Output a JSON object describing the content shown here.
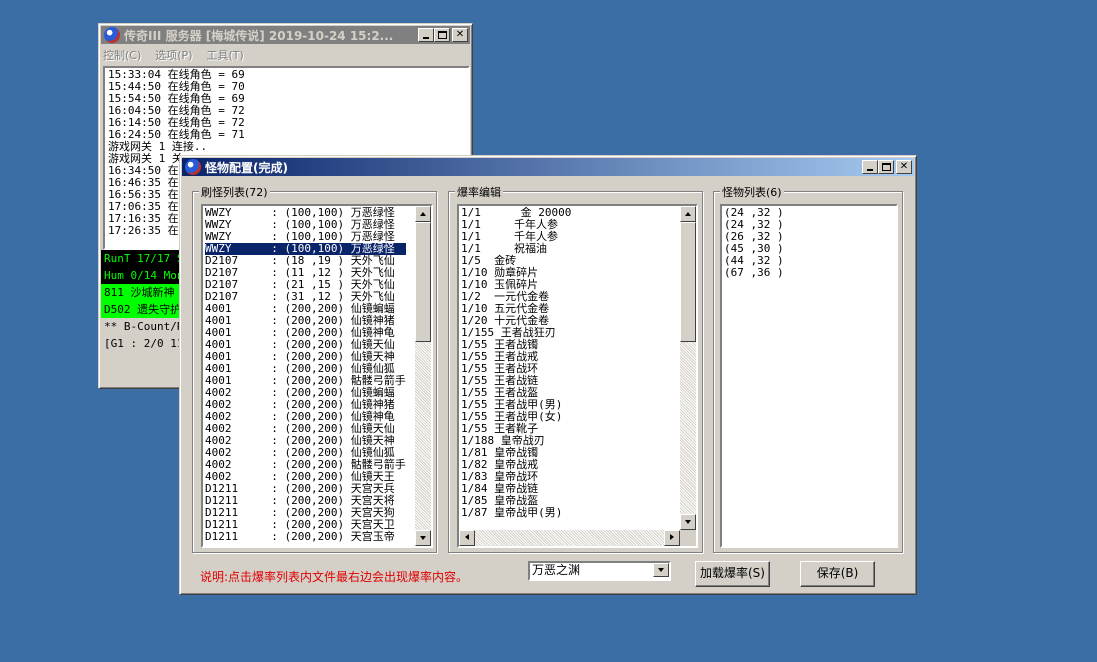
{
  "colors": {
    "desktop": "#3a6ea5",
    "title_active": "#0a246a",
    "status_green": "#00ff00",
    "status_black": "#000000",
    "note_red": "#e00000"
  },
  "server_window": {
    "title": "传奇III 服务器 [梅城传说] 2019-10-24 15:2...",
    "menu": [
      "控制(C)",
      "选项(P)",
      "工具(T)"
    ],
    "log_lines": [
      "15:33:04 在线角色 = 69",
      "15:44:50 在线角色 = 70",
      "15:54:50 在线角色 = 69",
      "16:04:50 在线角色 = 72",
      "16:14:50 在线角色 = 72",
      "16:24:50 在线角色 = 71",
      "游戏网关 1 连接..",
      "游戏网关 1 关",
      "16:34:50 在线",
      "16:46:35 在线",
      "16:56:35 在线",
      "17:06:35 在线",
      "17:16:35 在线",
      "17:26:35 在线"
    ],
    "status_lines": [
      "RunT 17/17 So",
      "Hum 0/14 Mon",
      "811 沙城新神",
      "D502 遗失守护",
      "** B-Count/Re",
      "[G1 : 2/0 11"
    ]
  },
  "monster_window": {
    "title": "怪物配置(完成)",
    "spawn_group_label": "刷怪列表(72)",
    "spawn_list": [
      "WWZY      : (100,100) 万恶绿怪",
      "WWZY      : (100,100) 万恶绿怪",
      "WWZY      : (100,100) 万恶绿怪",
      "WWZY      : (100,100) 万恶绿怪",
      "D2107     : (18 ,19 ) 天外飞仙",
      "D2107     : (11 ,12 ) 天外飞仙",
      "D2107     : (21 ,15 ) 天外飞仙",
      "D2107     : (31 ,12 ) 天外飞仙",
      "4001      : (200,200) 仙镜蝙蝠",
      "4001      : (200,200) 仙镜神猪",
      "4001      : (200,200) 仙镜神龟",
      "4001      : (200,200) 仙镜天仙",
      "4001      : (200,200) 仙镜天神",
      "4001      : (200,200) 仙镜仙狐",
      "4001      : (200,200) 骷髅弓箭手",
      "4002      : (200,200) 仙镜蝙蝠",
      "4002      : (200,200) 仙镜神猪",
      "4002      : (200,200) 仙镜神龟",
      "4002      : (200,200) 仙镜天仙",
      "4002      : (200,200) 仙镜天神",
      "4002      : (200,200) 仙镜仙狐",
      "4002      : (200,200) 骷髅弓箭手",
      "4002      : (200,200) 仙镜天王",
      "D1211     : (200,200) 天宫天兵",
      "D1211     : (200,200) 天宫天将",
      "D1211     : (200,200) 天宫天狗",
      "D1211     : (200,200) 天宫天卫",
      "D1211     : (200,200) 天宫玉帝"
    ],
    "spawn_selected_index": 3,
    "drop_group_label": "爆率编辑",
    "drop_list": [
      "1/1      金 20000",
      "1/1     千年人参",
      "1/1     千年人参",
      "1/1     祝福油",
      "1/5  金砖",
      "1/10 勋章碎片",
      "1/10 玉佩碎片",
      "1/2  一元代金卷",
      "1/10 五元代金卷",
      "1/20 十元代金卷",
      "1/155 王者战狂刃",
      "1/55 王者战镯",
      "1/55 王者战戒",
      "1/55 王者战环",
      "1/55 王者战链",
      "1/55 王者战盔",
      "1/55 王者战甲(男)",
      "1/55 王者战甲(女)",
      "1/55 王者靴子",
      "1/188 皇帝战刃",
      "1/81 皇帝战镯",
      "1/82 皇帝战戒",
      "1/83 皇帝战环",
      "1/84 皇帝战链",
      "1/85 皇帝战盔",
      "1/87 皇帝战甲(男)"
    ],
    "monster_group_label": "怪物列表(6)",
    "monster_list": [
      "(24 ,32 )",
      "(24 ,32 )",
      "(26 ,32 )",
      "(45 ,30 )",
      "(44 ,32 )",
      "(67 ,36 )"
    ],
    "note": "说明:点击爆率列表内文件最右边会出现爆率内容。",
    "map_select_value": "万恶之渊",
    "load_button": "加载爆率(S)",
    "save_button": "保存(B)"
  }
}
